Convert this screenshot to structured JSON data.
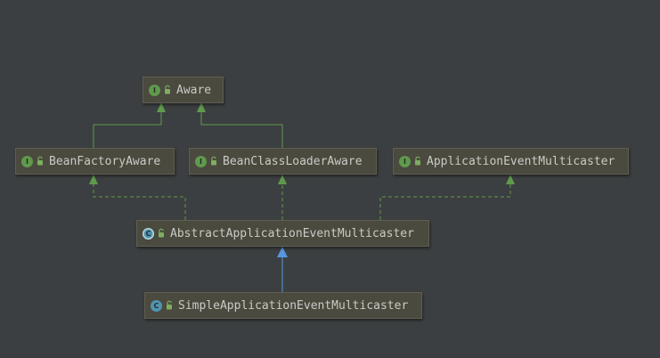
{
  "nodes": [
    {
      "key": "aware",
      "label": "Aware",
      "kind": "interface",
      "kind_letter": "I",
      "icon": "interface-icon"
    },
    {
      "key": "bean_factory_aware",
      "label": "BeanFactoryAware",
      "kind": "interface",
      "kind_letter": "I",
      "icon": "interface-icon"
    },
    {
      "key": "bean_class_loader_aware",
      "label": "BeanClassLoaderAware",
      "kind": "interface",
      "kind_letter": "I",
      "icon": "interface-icon"
    },
    {
      "key": "application_event_multicaster",
      "label": "ApplicationEventMulticaster",
      "kind": "interface",
      "kind_letter": "I",
      "icon": "interface-icon"
    },
    {
      "key": "abstract_application_event_multicaster",
      "label": "AbstractApplicationEventMulticaster",
      "kind": "abstract-class",
      "kind_letter": "C",
      "icon": "abstract-class-icon"
    },
    {
      "key": "simple_application_event_multicaster",
      "label": "SimpleApplicationEventMulticaster",
      "kind": "class",
      "kind_letter": "C",
      "icon": "class-icon"
    }
  ],
  "edges": [
    {
      "from": "bean_factory_aware",
      "to": "aware",
      "relation": "extends"
    },
    {
      "from": "bean_class_loader_aware",
      "to": "aware",
      "relation": "extends"
    },
    {
      "from": "abstract_application_event_multicaster",
      "to": "bean_factory_aware",
      "relation": "implements"
    },
    {
      "from": "abstract_application_event_multicaster",
      "to": "bean_class_loader_aware",
      "relation": "implements"
    },
    {
      "from": "abstract_application_event_multicaster",
      "to": "application_event_multicaster",
      "relation": "implements"
    },
    {
      "from": "simple_application_event_multicaster",
      "to": "abstract_application_event_multicaster",
      "relation": "extends-class"
    }
  ],
  "colors": {
    "background": "#3c3f41",
    "node_fill": "#4b4a3f",
    "node_border": "#5f5e52",
    "text": "#c9cbc6",
    "interface_edge": "#5f9a4c",
    "class_edge": "#5895e0",
    "interface_icon": "#5f9a4c",
    "class_icon": "#4f95b0"
  }
}
